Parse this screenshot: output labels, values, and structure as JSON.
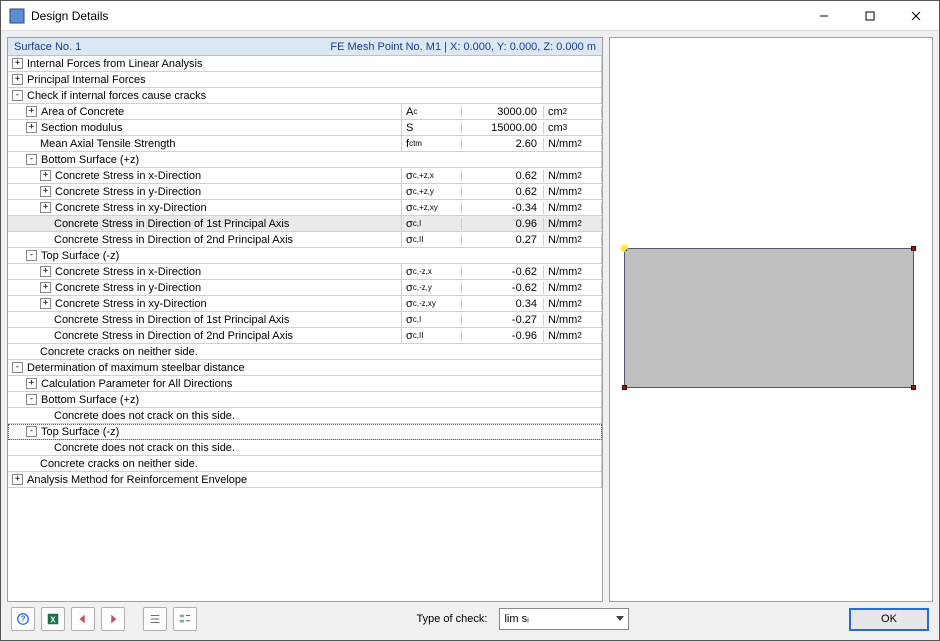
{
  "window": {
    "title": "Design Details"
  },
  "header": {
    "left": "Surface No. 1",
    "right": "FE Mesh Point No. M1  |  X: 0.000, Y: 0.000, Z: 0.000 m"
  },
  "footer": {
    "type_of_check_label": "Type of check:",
    "type_of_check_value": "lim sᵢ",
    "ok": "OK"
  },
  "rows": [
    {
      "indent": 0,
      "exp": "+",
      "label": "Internal Forces from Linear Analysis",
      "sym": "",
      "val": "",
      "unit": "",
      "full": true
    },
    {
      "indent": 0,
      "exp": "+",
      "label": "Principal Internal Forces",
      "sym": "",
      "val": "",
      "unit": "",
      "full": true
    },
    {
      "indent": 0,
      "exp": "-",
      "label": "Check if internal forces cause cracks",
      "sym": "",
      "val": "",
      "unit": "",
      "full": true
    },
    {
      "indent": 1,
      "exp": "+",
      "label": "Area of Concrete",
      "sym": "A<span class='sub'>c</span>",
      "val": "3000.00",
      "unit": "cm<span class='sup'>2</span>"
    },
    {
      "indent": 1,
      "exp": "+",
      "label": "Section modulus",
      "sym": "S",
      "val": "15000.00",
      "unit": "cm<span class='sup'>3</span>"
    },
    {
      "indent": 1,
      "exp": "",
      "label": "Mean Axial Tensile Strength",
      "sym": "f<span class='sub'>ctm</span>",
      "val": "2.60",
      "unit": "N/mm<span class='sup'>2</span>"
    },
    {
      "indent": 1,
      "exp": "-",
      "label": "Bottom Surface (+z)",
      "sym": "",
      "val": "",
      "unit": "",
      "full": true
    },
    {
      "indent": 2,
      "exp": "+",
      "label": "Concrete Stress in x-Direction",
      "sym": "σ<span class='sub'>c,+z,x</span>",
      "val": "0.62",
      "unit": "N/mm<span class='sup'>2</span>"
    },
    {
      "indent": 2,
      "exp": "+",
      "label": "Concrete Stress in y-Direction",
      "sym": "σ<span class='sub'>c,+z,y</span>",
      "val": "0.62",
      "unit": "N/mm<span class='sup'>2</span>"
    },
    {
      "indent": 2,
      "exp": "+",
      "label": "Concrete Stress in xy-Direction",
      "sym": "σ<span class='sub'>c,+z,xy</span>",
      "val": "-0.34",
      "unit": "N/mm<span class='sup'>2</span>"
    },
    {
      "indent": 2,
      "exp": "",
      "label": "Concrete Stress in Direction of 1st Principal Axis",
      "sym": "σ<span class='sub'>c,I</span>",
      "val": "0.96",
      "unit": "N/mm<span class='sup'>2</span>",
      "selected": true
    },
    {
      "indent": 2,
      "exp": "",
      "label": "Concrete Stress in Direction of 2nd Principal Axis",
      "sym": "σ<span class='sub'>c,II</span>",
      "val": "0.27",
      "unit": "N/mm<span class='sup'>2</span>"
    },
    {
      "indent": 1,
      "exp": "-",
      "label": "Top Surface (-z)",
      "sym": "",
      "val": "",
      "unit": "",
      "full": true
    },
    {
      "indent": 2,
      "exp": "+",
      "label": "Concrete Stress in x-Direction",
      "sym": "σ<span class='sub'>c,-z,x</span>",
      "val": "-0.62",
      "unit": "N/mm<span class='sup'>2</span>"
    },
    {
      "indent": 2,
      "exp": "+",
      "label": "Concrete Stress in y-Direction",
      "sym": "σ<span class='sub'>c,-z,y</span>",
      "val": "-0.62",
      "unit": "N/mm<span class='sup'>2</span>"
    },
    {
      "indent": 2,
      "exp": "+",
      "label": "Concrete Stress in xy-Direction",
      "sym": "σ<span class='sub'>c,-z,xy</span>",
      "val": "0.34",
      "unit": "N/mm<span class='sup'>2</span>"
    },
    {
      "indent": 2,
      "exp": "",
      "label": "Concrete Stress in Direction of 1st Principal Axis",
      "sym": "σ<span class='sub'>c,I</span>",
      "val": "-0.27",
      "unit": "N/mm<span class='sup'>2</span>"
    },
    {
      "indent": 2,
      "exp": "",
      "label": "Concrete Stress in Direction of 2nd Principal Axis",
      "sym": "σ<span class='sub'>c,II</span>",
      "val": "-0.96",
      "unit": "N/mm<span class='sup'>2</span>"
    },
    {
      "indent": 1,
      "exp": "",
      "label": "Concrete cracks on neither side.",
      "sym": "",
      "val": "",
      "unit": "",
      "full": true
    },
    {
      "indent": 0,
      "exp": "-",
      "label": "Determination of maximum steelbar distance",
      "sym": "",
      "val": "",
      "unit": "",
      "full": true
    },
    {
      "indent": 1,
      "exp": "+",
      "label": "Calculation Parameter for All Directions",
      "sym": "",
      "val": "",
      "unit": "",
      "full": true
    },
    {
      "indent": 1,
      "exp": "-",
      "label": "Bottom Surface (+z)",
      "sym": "",
      "val": "",
      "unit": "",
      "full": true
    },
    {
      "indent": 2,
      "exp": "",
      "label": "Concrete does not crack on this side.",
      "sym": "",
      "val": "",
      "unit": "",
      "full": true
    },
    {
      "indent": 1,
      "exp": "-",
      "label": "Top Surface (-z)",
      "sym": "",
      "val": "",
      "unit": "",
      "full": true,
      "dotted": true
    },
    {
      "indent": 2,
      "exp": "",
      "label": "Concrete does not crack on this side.",
      "sym": "",
      "val": "",
      "unit": "",
      "full": true
    },
    {
      "indent": 1,
      "exp": "",
      "label": "Concrete cracks on neither side.",
      "sym": "",
      "val": "",
      "unit": "",
      "full": true
    },
    {
      "indent": 0,
      "exp": "+",
      "label": "Analysis Method for Reinforcement Envelope",
      "sym": "",
      "val": "",
      "unit": "",
      "full": true
    }
  ]
}
